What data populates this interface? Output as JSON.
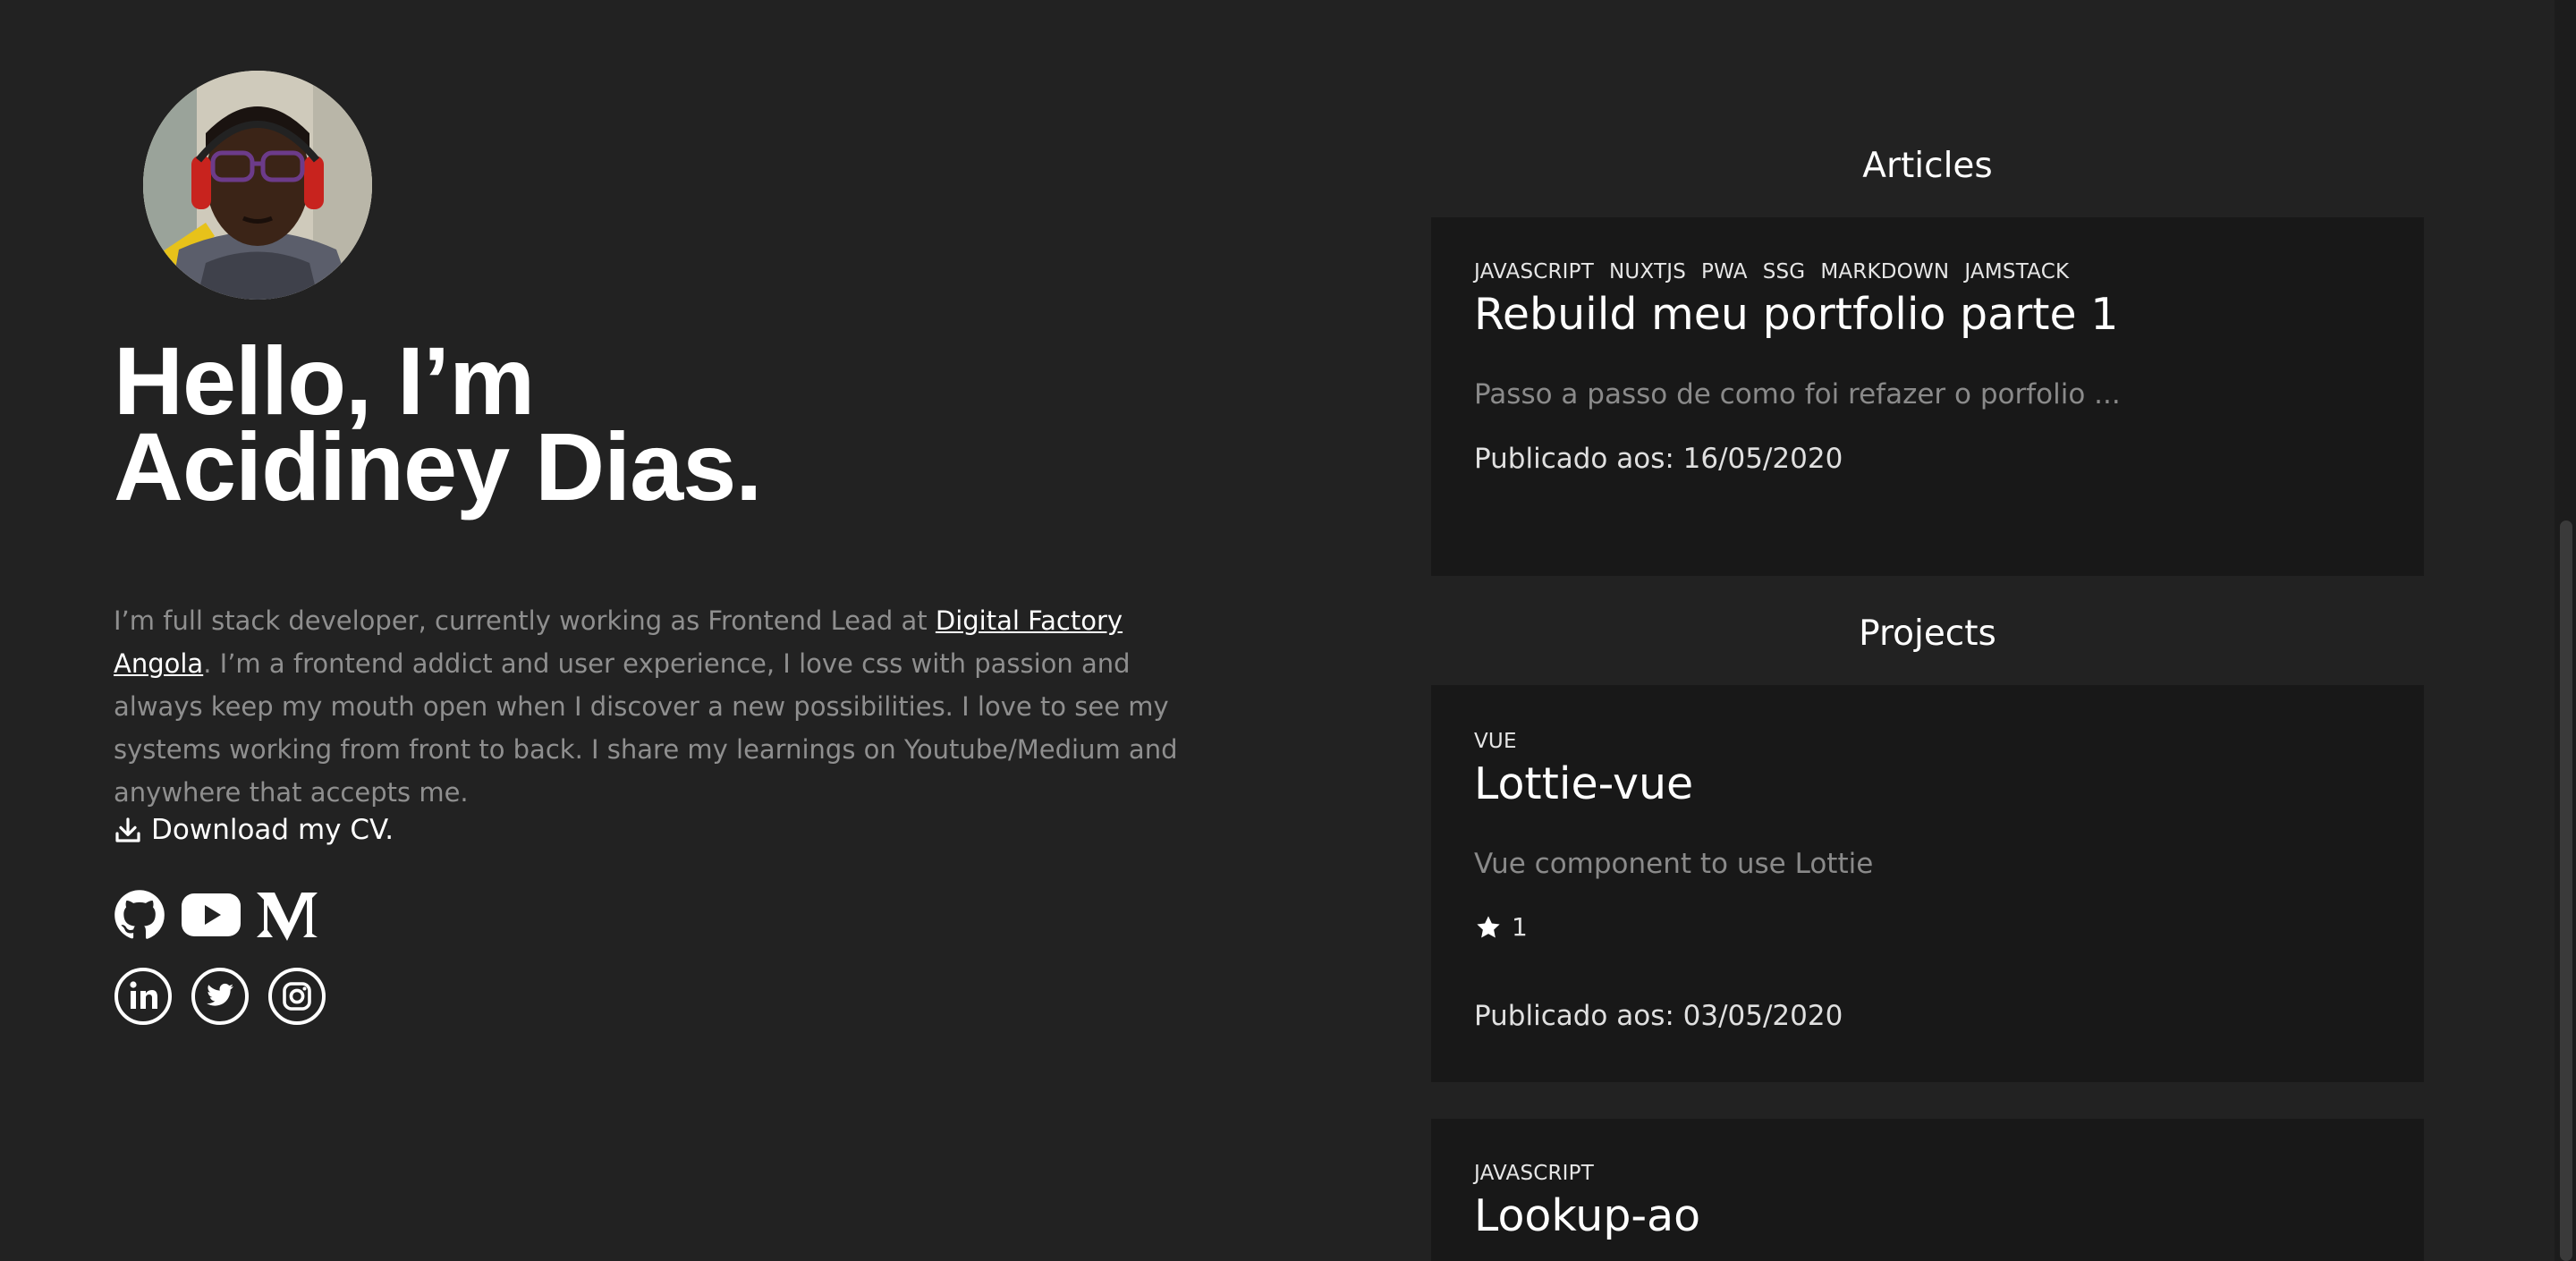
{
  "profile": {
    "avatar_alt": "Acidiney Dias",
    "greeting": "Hello, I’m",
    "name": "Acidiney Dias.",
    "bio_prefix": "I’m full stack developer, currently working as Frontend Lead at ",
    "company_link": "Digital Factory Angola",
    "bio_suffix": ". I’m a frontend addict and user experience, I love css with passion and always keep my mouth open when I discover a new possibilities. I love to see my systems working from front to back. I share my learnings on Youtube/Medium and anywhere that accepts me.",
    "cv_label": "Download my CV."
  },
  "social": {
    "row1": [
      {
        "icon": "github-icon"
      },
      {
        "icon": "youtube-icon"
      },
      {
        "icon": "medium-icon"
      }
    ],
    "row2": [
      {
        "icon": "linkedin-icon"
      },
      {
        "icon": "twitter-icon"
      },
      {
        "icon": "instagram-icon"
      }
    ]
  },
  "articles": {
    "title": "Articles",
    "items": [
      {
        "tags": [
          "JAVASCRIPT",
          "NUXTJS",
          "PWA",
          "SSG",
          "MARKDOWN",
          "JAMSTACK"
        ],
        "title": "Rebuild meu portfolio parte 1",
        "description": "Passo a passo de como foi refazer o porfolio ...",
        "date": "Publicado aos: 16/05/2020"
      }
    ]
  },
  "projects": {
    "title": "Projects",
    "items": [
      {
        "tags": [
          "VUE"
        ],
        "title": "Lottie-vue",
        "description": "Vue component to use Lottie",
        "stars": "1",
        "date": "Publicado aos: 03/05/2020"
      },
      {
        "tags": [
          "JAVASCRIPT"
        ],
        "title": "Lookup-ao"
      }
    ]
  },
  "colors": {
    "background": "#222222",
    "card": "#181818",
    "text": "#ffffff",
    "muted": "#8f8f8f"
  }
}
